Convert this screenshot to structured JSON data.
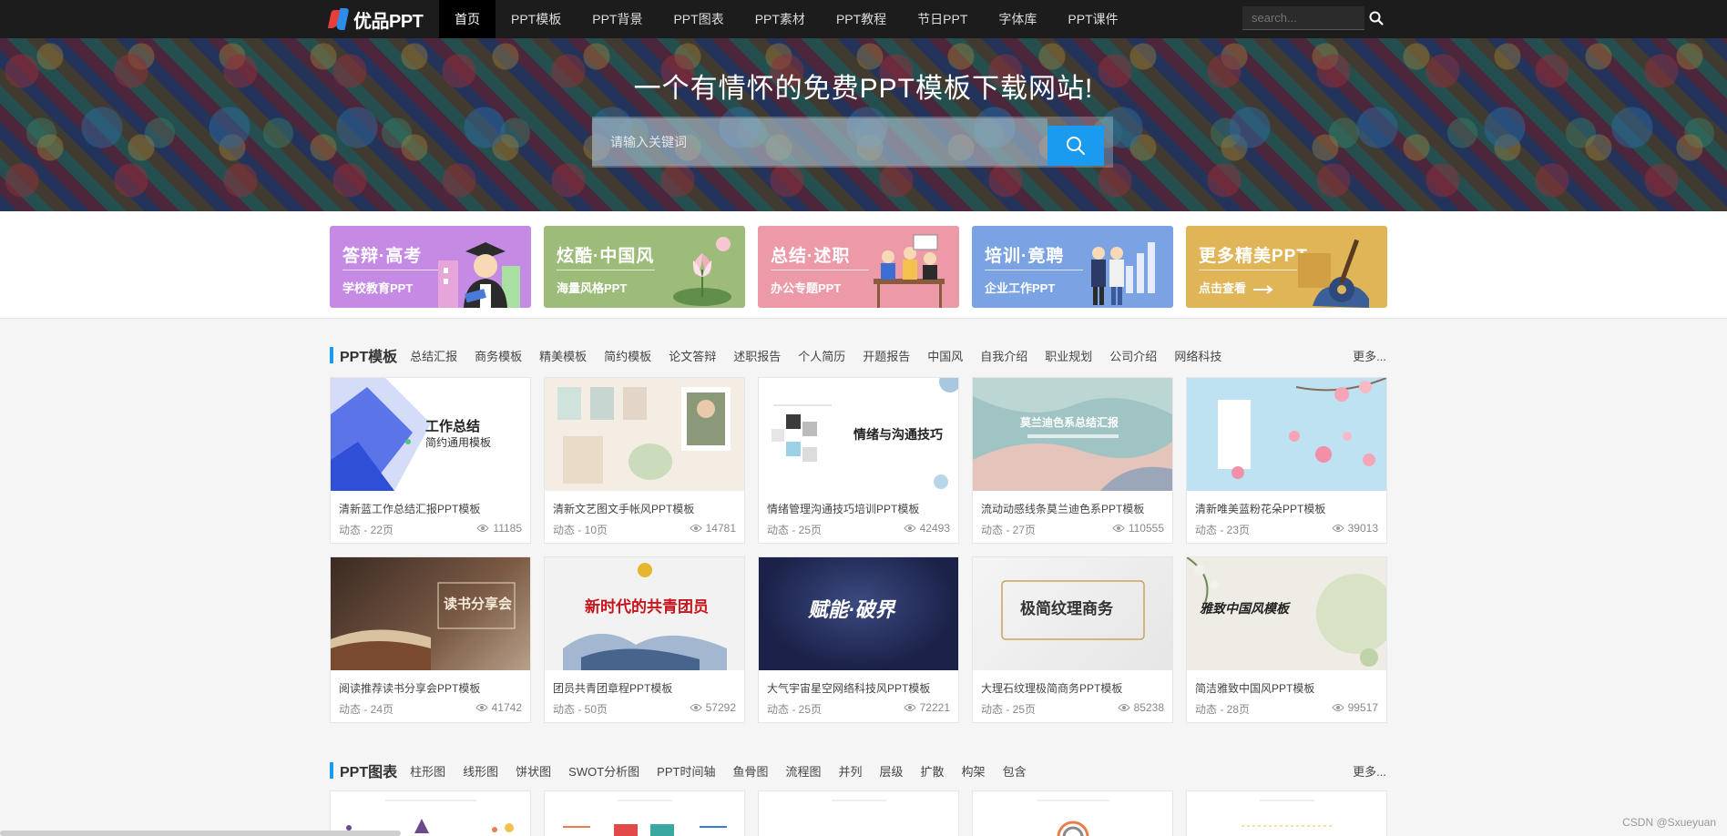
{
  "nav": {
    "logo": "优品PPT",
    "items": [
      {
        "label": "首页",
        "active": true
      },
      {
        "label": "PPT模板"
      },
      {
        "label": "PPT背景"
      },
      {
        "label": "PPT图表"
      },
      {
        "label": "PPT素材"
      },
      {
        "label": "PPT教程"
      },
      {
        "label": "节日PPT"
      },
      {
        "label": "字体库"
      },
      {
        "label": "PPT课件"
      }
    ],
    "search_placeholder": "search..."
  },
  "banner": {
    "title": "一个有情怀的免费PPT模板下载网站!",
    "search_placeholder": "请输入关键词"
  },
  "categories": [
    {
      "title": "答辩·高考",
      "sub": "学校教育PPT",
      "color": "#c58be4"
    },
    {
      "title": "炫酷·中国风",
      "sub": "海量风格PPT",
      "color": "#9dbb79"
    },
    {
      "title": "总结·述职",
      "sub": "办公专题PPT",
      "color": "#ec9aa8"
    },
    {
      "title": "培训·竟聘",
      "sub": "企业工作PPT",
      "color": "#7ba2e3"
    },
    {
      "title": "更多精美PPT",
      "sub": "点击查看",
      "color": "#e0b558"
    }
  ],
  "templates_section": {
    "title": "PPT模板",
    "tags": [
      "总结汇报",
      "商务模板",
      "精美模板",
      "简约模板",
      "论文答辩",
      "述职报告",
      "个人简历",
      "开题报告",
      "中国风",
      "自我介绍",
      "职业规划",
      "公司介绍",
      "网络科技"
    ],
    "more": "更多..."
  },
  "templates": [
    {
      "title": "清新蓝工作总结汇报PPT模板",
      "meta": "动态 - 22页",
      "views": "11185",
      "thumb_text": "工作总结",
      "thumb_sub": "简约通用模板"
    },
    {
      "title": "清新文艺图文手帐风PPT模板",
      "meta": "动态 - 10页",
      "views": "14781"
    },
    {
      "title": "情绪管理沟通技巧培训PPT模板",
      "meta": "动态 - 25页",
      "views": "42493",
      "thumb_text": "情绪与沟通技巧"
    },
    {
      "title": "流动动感线条莫兰迪色系PPT模板",
      "meta": "动态 - 27页",
      "views": "110555",
      "thumb_text": "莫兰迪色系总结汇报"
    },
    {
      "title": "清新唯美蓝粉花朵PPT模板",
      "meta": "动态 - 23页",
      "views": "39013"
    },
    {
      "title": "阅读推荐读书分享会PPT模板",
      "meta": "动态 - 24页",
      "views": "41742",
      "thumb_text": "读书分享会"
    },
    {
      "title": "团员共青团章程PPT模板",
      "meta": "动态 - 50页",
      "views": "57292",
      "thumb_text": "新时代的共青团员"
    },
    {
      "title": "大气宇宙星空网络科技风PPT模板",
      "meta": "动态 - 25页",
      "views": "72221",
      "thumb_text": "赋能·破界"
    },
    {
      "title": "大理石纹理极简商务PPT模板",
      "meta": "动态 - 25页",
      "views": "85238",
      "thumb_text": "极简纹理商务"
    },
    {
      "title": "简洁雅致中国风PPT模板",
      "meta": "动态 - 28页",
      "views": "99517",
      "thumb_text": "雅致中国风模板"
    }
  ],
  "charts_section": {
    "title": "PPT图表",
    "tags": [
      "柱形图",
      "线形图",
      "饼状图",
      "SWOT分析图",
      "PPT时间轴",
      "鱼骨图",
      "流程图",
      "并列",
      "层级",
      "扩散",
      "构架",
      "包含"
    ],
    "more": "更多..."
  },
  "watermark": "CSDN @Sxueyuan"
}
